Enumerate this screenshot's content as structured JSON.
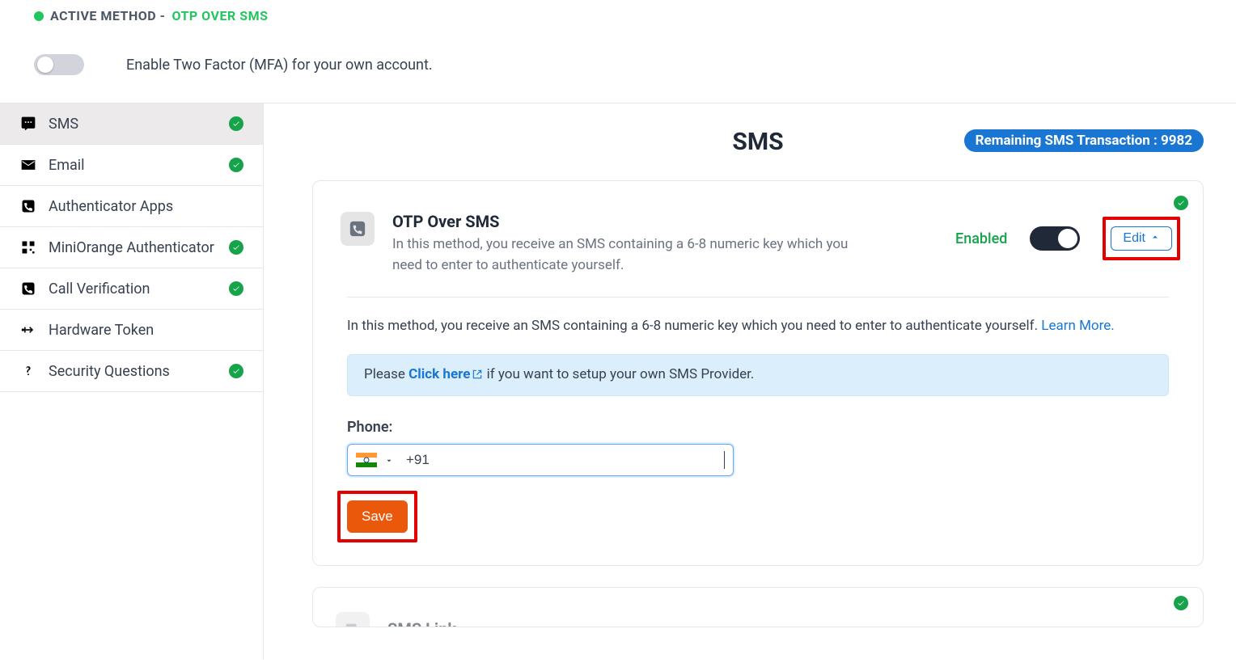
{
  "header": {
    "active_method_label": "ACTIVE METHOD - ",
    "active_method_value": "OTP OVER SMS",
    "mfa_toggle_text": "Enable Two Factor (MFA) for your own account."
  },
  "sidebar": {
    "items": [
      {
        "label": "SMS",
        "checked": true,
        "icon": "sms"
      },
      {
        "label": "Email",
        "checked": true,
        "icon": "mail"
      },
      {
        "label": "Authenticator Apps",
        "checked": false,
        "icon": "phone-sq"
      },
      {
        "label": "MiniOrange Authenticator",
        "checked": true,
        "icon": "qr"
      },
      {
        "label": "Call Verification",
        "checked": true,
        "icon": "phone-sq"
      },
      {
        "label": "Hardware Token",
        "checked": false,
        "icon": "usb"
      },
      {
        "label": "Security Questions",
        "checked": true,
        "icon": "question"
      }
    ]
  },
  "main": {
    "title": "SMS",
    "remaining_label": "Remaining SMS Transaction : ",
    "remaining_value": "9982",
    "card1": {
      "title": "OTP Over SMS",
      "desc": "In this method, you receive an SMS containing a 6-8 numeric key which you need to enter to authenticate yourself.",
      "enabled_text": "Enabled",
      "edit_label": "Edit",
      "body_desc": "In this method, you receive an SMS containing a 6-8 numeric key which you need to enter to authenticate yourself. ",
      "learn_more": "Learn More.",
      "info_prefix": "Please ",
      "info_link": "Click here",
      "info_suffix": " if you want to setup your own SMS Provider.",
      "phone_label": "Phone:",
      "phone_value": "+91",
      "save_label": "Save"
    },
    "card2": {
      "title": "SMS Link"
    }
  }
}
